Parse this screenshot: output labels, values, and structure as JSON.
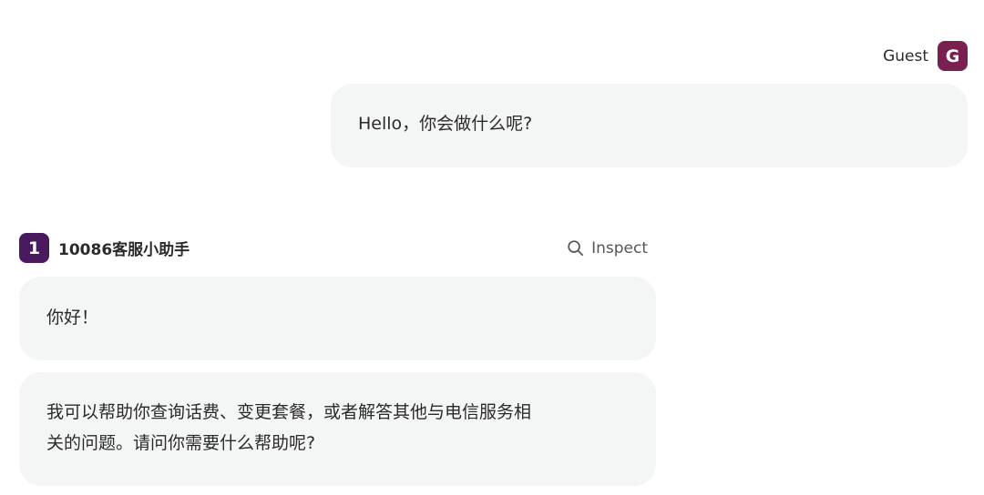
{
  "user": {
    "name": "Guest",
    "avatar_letter": "G",
    "message": "Hello，你会做什么呢?"
  },
  "assistant": {
    "avatar_letter": "1",
    "name": "10086客服小助手",
    "inspect_label": "Inspect",
    "messages": [
      {
        "lines": [
          "你好！"
        ]
      },
      {
        "lines": [
          "我可以帮助你查询话费、变更套餐，或者解答其他与电信服务相",
          "关的问题。请问你需要什么帮助呢?"
        ]
      }
    ]
  },
  "colors": {
    "user_avatar": "#7a1f52",
    "bot_avatar": "#4a1a5e",
    "bubble_bg": "#f4f6f5"
  },
  "icons": [
    "search-icon"
  ]
}
